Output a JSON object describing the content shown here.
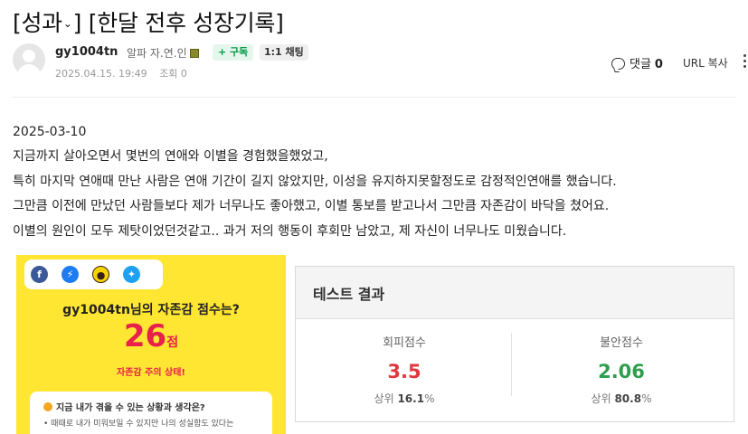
{
  "title": {
    "category": "[성과",
    "category_close": "]",
    "chevron": "⌄",
    "subject": "[한달 전후 성장기록]"
  },
  "author": {
    "nickname": "gy1004tn",
    "grade": "알파 자.연.인",
    "subscribe_label": "+ 구독",
    "chat_label": "1:1 채팅",
    "date": "2025.04.15. 19:49",
    "views": "조회 0"
  },
  "actions": {
    "comment_label": "댓글",
    "comment_count": "0",
    "url_copy": "URL 복사"
  },
  "body": {
    "lines": [
      "2025-03-10",
      "지금까지 살아오면서 몇번의 연애와 이별을 경험했을했었고,",
      "특히 마지막 연애때 만난 사람은 연애 기간이 길지 않았지만, 이성을 유지하지못할정도로 감정적인연애를 했습니다.",
      "그만큼 이전에 만났던 사람들보다 제가 너무나도 좋아했고, 이별 통보를 받고나서 그만큼 자존감이 바닥을 쳤어요.",
      "이별의 원인이 모두 제탓이었던것같고.. 과거 저의 행동이 후회만 남았고, 제 자신이 너무나도 미웠습니다."
    ]
  },
  "score_card": {
    "share_icons": [
      "facebook-icon",
      "messenger-icon",
      "kakaotalk-icon",
      "twitter-icon"
    ],
    "title": "gy1004tn님의 자존감 점수는?",
    "score": "26",
    "score_unit": "점",
    "state": "자존감 주의 상태!",
    "situation_title": "지금 내가 겪을 수 있는 상황과 생각은?",
    "situation_text": "• 때때로 내가 미워보일 수 있지만 나의 성실함도 있다는",
    "background_color": "#ffe633",
    "accent_color": "#e8214a"
  },
  "test_result": {
    "header": "테스트 결과",
    "avoidance": {
      "label": "회피점수",
      "value": "3.5",
      "rank_prefix": "상위",
      "rank_value": "16.1",
      "rank_unit": "%",
      "color": "#e0383e"
    },
    "anxiety": {
      "label": "불안점수",
      "value": "2.06",
      "rank_prefix": "상위",
      "rank_value": "80.8",
      "rank_unit": "%",
      "color": "#2e9e4f"
    }
  }
}
